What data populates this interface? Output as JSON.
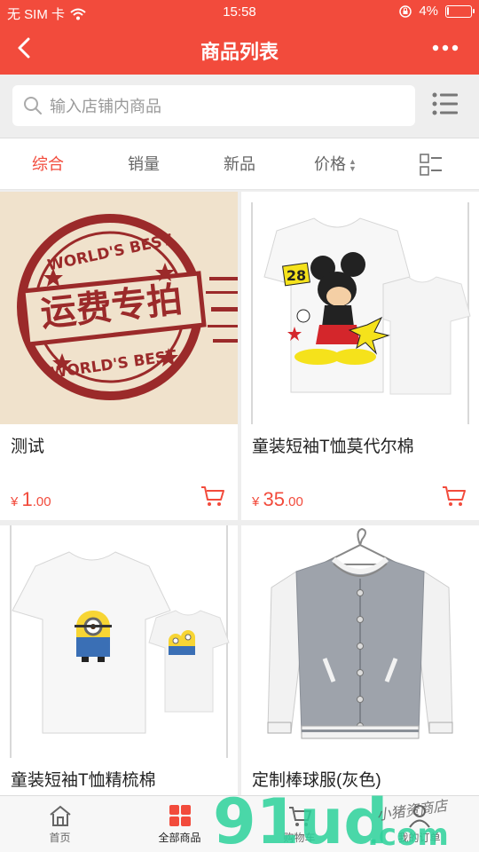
{
  "status": {
    "carrier": "无 SIM 卡",
    "time": "15:58",
    "battery_text": "4%",
    "battery_level": 0.04
  },
  "nav": {
    "title": "商品列表"
  },
  "search": {
    "placeholder": "输入店铺内商品"
  },
  "tabs": [
    {
      "label": "综合",
      "active": true
    },
    {
      "label": "销量",
      "active": false
    },
    {
      "label": "新品",
      "active": false
    },
    {
      "label": "价格",
      "active": false
    }
  ],
  "products": [
    {
      "name": "测试",
      "currency": "¥",
      "price_int": "1",
      "price_dec": ".00",
      "stamp_text": "运费专拍",
      "stamp_ring": "WORLD'S BEST"
    },
    {
      "name": "童装短袖T恤莫代尔棉",
      "currency": "¥",
      "price_int": "35",
      "price_dec": ".00",
      "shirt_number": "28"
    },
    {
      "name": "童装短袖T恤精梳棉"
    },
    {
      "name": "定制棒球服(灰色)"
    }
  ],
  "bottom_tabs": [
    {
      "label": "首页",
      "icon": "home-icon"
    },
    {
      "label": "全部商品",
      "icon": "grid-icon",
      "active": true
    },
    {
      "label": "购物车",
      "icon": "cart-icon"
    },
    {
      "label": "我的订单",
      "icon": "user-icon"
    }
  ],
  "watermark": {
    "logo": "91ud",
    "suffix": ".com",
    "tagline": "小猪资商店"
  },
  "colors": {
    "accent": "#f24b3c",
    "background": "#eeeeee"
  }
}
